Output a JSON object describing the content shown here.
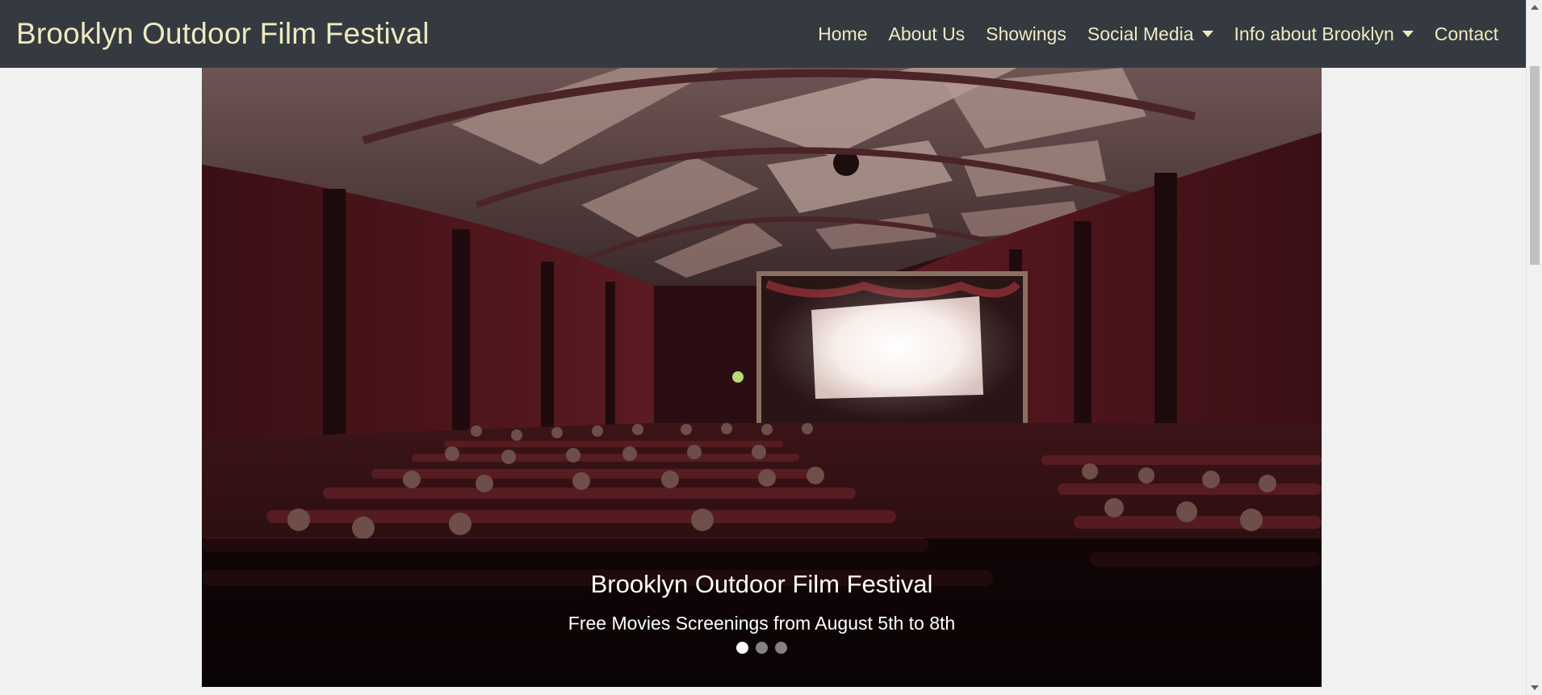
{
  "navbar": {
    "brand": "Brooklyn Outdoor Film Festival",
    "links": [
      {
        "label": "Home",
        "dropdown": false
      },
      {
        "label": "About Us",
        "dropdown": false
      },
      {
        "label": "Showings",
        "dropdown": false
      },
      {
        "label": "Social Media",
        "dropdown": true
      },
      {
        "label": "Info about Brooklyn",
        "dropdown": true
      },
      {
        "label": "Contact",
        "dropdown": false
      }
    ]
  },
  "carousel": {
    "caption_title": "Brooklyn Outdoor Film Festival",
    "caption_subtitle": "Free Movies Screenings from August 5th to 8th",
    "slide_count": 3,
    "active_slide": 1
  },
  "colors": {
    "navbar_bg": "#343a40",
    "nav_text": "#f0e9c0",
    "page_bg": "#f1f1f1"
  }
}
